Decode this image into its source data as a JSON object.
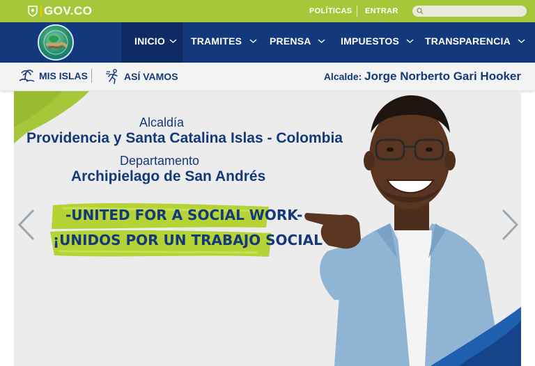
{
  "topbar": {
    "gov_label": "GOV.CO",
    "links": [
      {
        "label": "POLÍTICAS"
      },
      {
        "label": "ENTRAR"
      }
    ],
    "search_placeholder": ""
  },
  "nav": {
    "items": [
      {
        "label": "INICIO"
      },
      {
        "label": "TRAMITES"
      },
      {
        "label": "PRENSA"
      },
      {
        "label": "IMPUESTOS"
      },
      {
        "label": "TRANSPARENCIA"
      }
    ]
  },
  "subbar": {
    "mis_islas": "MIS ISLAS",
    "asi_vamos": "ASÍ VAMOS",
    "mayor_prefix": "Alcalde:",
    "mayor_name": "Jorge Norberto Gari Hooker"
  },
  "banner": {
    "line1": "Alcaldía",
    "line2": "Providencia y Santa Catalina Islas - Colombia",
    "line3": "Departamento",
    "line4": "Archipielago de San Andrés",
    "slogan1": "-UNITED FOR A SOCIAL WORK-",
    "slogan2": "¡UNIDOS POR UN TRABAJO SOCIAL !"
  },
  "colors": {
    "green": "#a6c73a",
    "navy": "#13397c",
    "navy_active": "#0e2c63",
    "slogan_green": "#b5d334"
  },
  "icons": [
    "shield-icon",
    "search-icon",
    "chevron-down-icon",
    "islands-icon",
    "runner-icon",
    "arrow-left-icon",
    "arrow-right-icon"
  ]
}
